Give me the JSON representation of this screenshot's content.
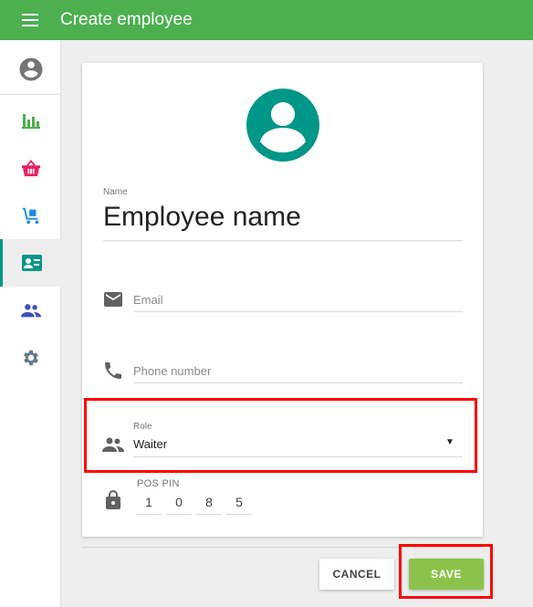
{
  "header": {
    "title": "Create employee",
    "menu_icon": "hamburger-menu-icon"
  },
  "sidebar": {
    "items": [
      {
        "name": "sidebar-item-account",
        "icon": "account-circle-icon",
        "color": "#757575"
      },
      {
        "name": "sidebar-item-reports",
        "icon": "bar-chart-icon",
        "color": "#4caf50"
      },
      {
        "name": "sidebar-item-sales",
        "icon": "basket-icon",
        "color": "#e91e63"
      },
      {
        "name": "sidebar-item-inventory",
        "icon": "dolly-icon",
        "color": "#1e88e5"
      },
      {
        "name": "sidebar-item-employees",
        "icon": "badge-icon",
        "color": "#009688",
        "active": true
      },
      {
        "name": "sidebar-item-customers",
        "icon": "people-icon",
        "color": "#3f51b5"
      },
      {
        "name": "sidebar-item-settings",
        "icon": "gear-icon",
        "color": "#607d8b"
      }
    ]
  },
  "form": {
    "avatar_color": "#009688",
    "name_label": "Name",
    "name_value": "Employee name",
    "email_placeholder": "Email",
    "phone_placeholder": "Phone number",
    "role_label": "Role",
    "role_value": "Waiter",
    "role_arrow": "▼",
    "pin_label": "POS PIN",
    "pin_digits": [
      "1",
      "0",
      "8",
      "5"
    ]
  },
  "actions": {
    "cancel": "CANCEL",
    "save": "SAVE"
  },
  "colors": {
    "accent": "#4caf50",
    "save": "#8bc34a",
    "highlight": "#ff0000"
  }
}
